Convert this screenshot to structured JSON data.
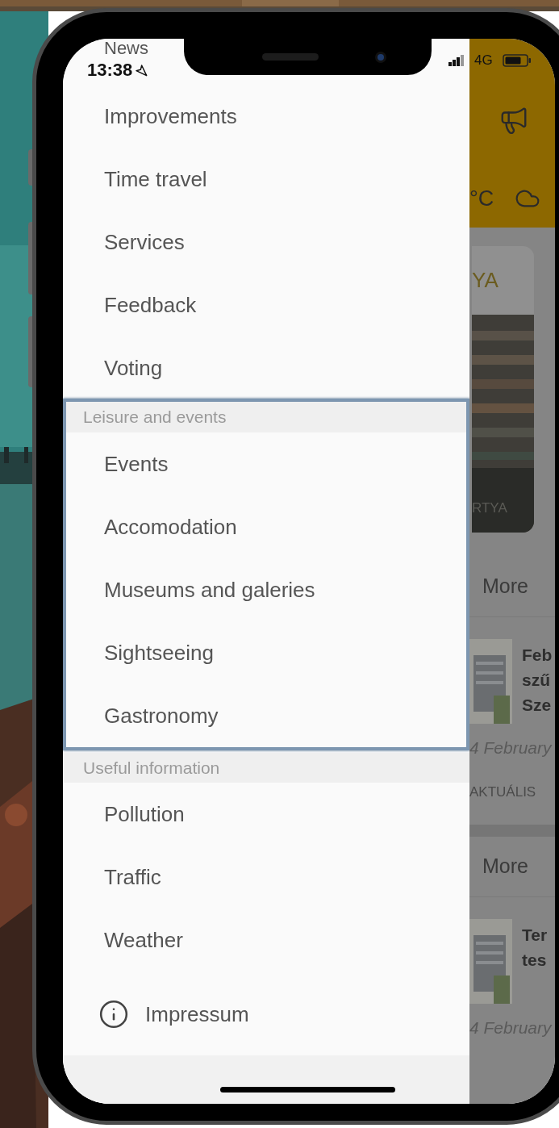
{
  "status_bar": {
    "time": "13:38",
    "network": "4G"
  },
  "drawer": {
    "top_item": "News",
    "items": [
      "Improvements",
      "Time travel",
      "Services",
      "Feedback",
      "Voting"
    ],
    "sections": [
      {
        "title": "Leisure and events",
        "highlighted": true,
        "items": [
          "Events",
          "Accomodation",
          "Museums and galeries",
          "Sightseeing",
          "Gastronomy"
        ]
      },
      {
        "title": "Useful information",
        "highlighted": false,
        "items": [
          "Pollution",
          "Traffic",
          "Weather"
        ]
      }
    ],
    "footer_item": "Impressum"
  },
  "app_behind": {
    "temperature_unit": "°C",
    "featured": {
      "heading": "YA",
      "caption": "RTYA"
    },
    "blocks": [
      {
        "more": "More",
        "article": {
          "title_lines": [
            "Feb",
            "szű",
            "Sze"
          ],
          "date": "4 February",
          "tag": "AKTUÁLIS"
        }
      },
      {
        "more": "More",
        "article": {
          "title_lines": [
            "Ter",
            "tes"
          ],
          "date": "4 February"
        }
      }
    ]
  }
}
